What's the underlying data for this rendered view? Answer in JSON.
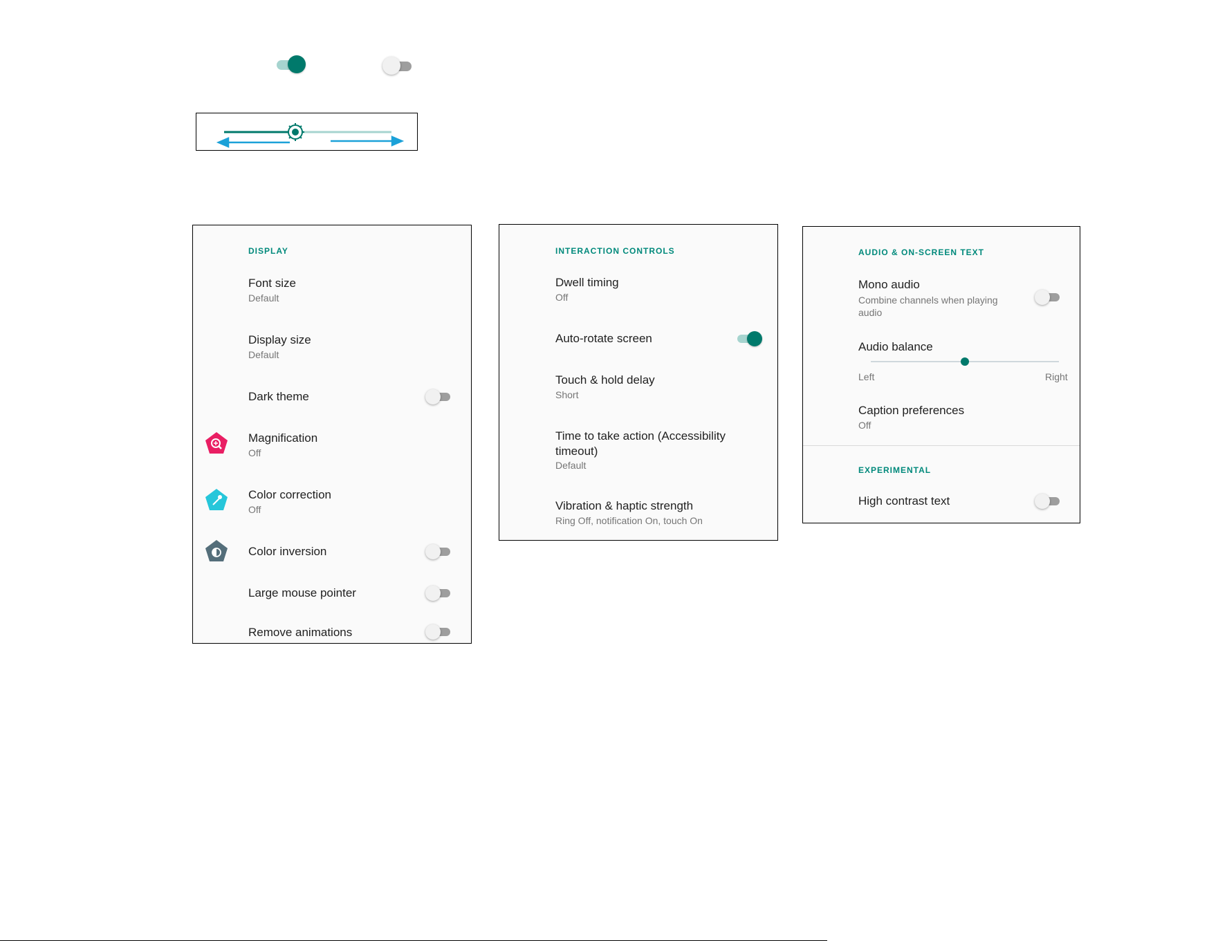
{
  "demo": {
    "toggle_on": true,
    "toggle_off": false,
    "brightness_level": 0.43,
    "colors": {
      "accent": "#00796b",
      "track": "#a6d4cf",
      "arrow": "#1ba1d8"
    }
  },
  "display_panel": {
    "header": "DISPLAY",
    "items": [
      {
        "title": "Font size",
        "subtitle": "Default"
      },
      {
        "title": "Display size",
        "subtitle": "Default"
      },
      {
        "title": "Dark theme",
        "toggle": false
      },
      {
        "title": "Magnification",
        "subtitle": "Off",
        "icon": "magnification-icon",
        "icon_color": "#e91e63"
      },
      {
        "title": "Color correction",
        "subtitle": "Off",
        "icon": "color-correction-icon",
        "icon_color": "#26c6da"
      },
      {
        "title": "Color inversion",
        "toggle": false,
        "icon": "color-inversion-icon",
        "icon_color": "#546e7a"
      },
      {
        "title": "Large mouse pointer",
        "toggle": false
      },
      {
        "title": "Remove animations",
        "toggle": false
      }
    ]
  },
  "interaction_panel": {
    "header": "INTERACTION CONTROLS",
    "items": [
      {
        "title": "Dwell timing",
        "subtitle": "Off"
      },
      {
        "title": "Auto-rotate screen",
        "toggle": true
      },
      {
        "title": "Touch & hold delay",
        "subtitle": "Short"
      },
      {
        "title": "Time to take action (Accessibility timeout)",
        "subtitle": "Default"
      },
      {
        "title": "Vibration & haptic strength",
        "subtitle": "Ring Off, notification On, touch On"
      }
    ]
  },
  "audio_panel": {
    "header": "AUDIO & ON-SCREEN TEXT",
    "mono_audio": {
      "title": "Mono audio",
      "subtitle": "Combine channels when playing audio",
      "toggle": false
    },
    "audio_balance": {
      "title": "Audio balance",
      "left_label": "Left",
      "right_label": "Right",
      "value": 0.5
    },
    "caption": {
      "title": "Caption preferences",
      "subtitle": "Off"
    },
    "experimental_header": "EXPERIMENTAL",
    "high_contrast": {
      "title": "High contrast text",
      "toggle": false
    }
  }
}
